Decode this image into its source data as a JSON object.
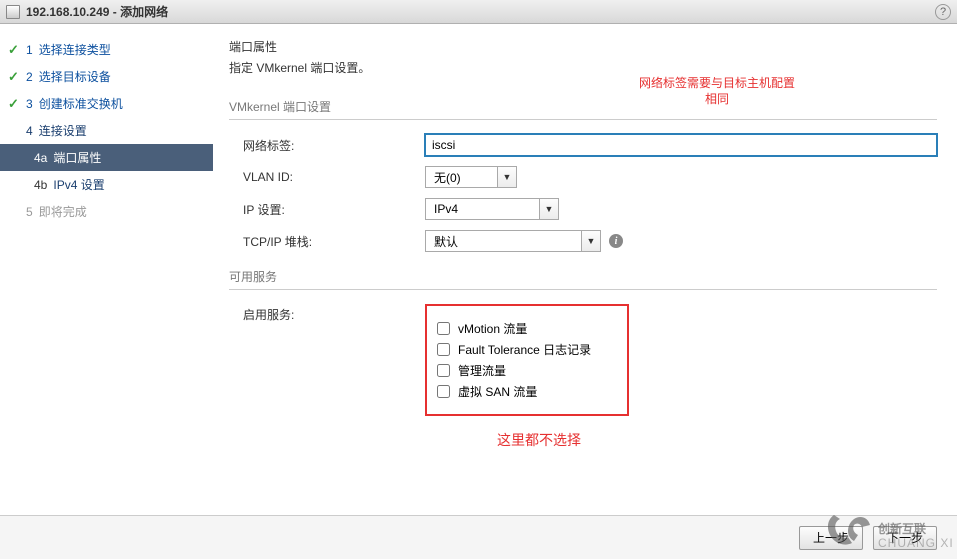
{
  "titlebar": {
    "host": "192.168.10.249",
    "suffix": " - 添加网络"
  },
  "sidebar": {
    "steps": [
      {
        "num": "1",
        "label": "选择连接类型",
        "done": true
      },
      {
        "num": "2",
        "label": "选择目标设备",
        "done": true
      },
      {
        "num": "3",
        "label": "创建标准交换机",
        "done": true
      },
      {
        "num": "4",
        "label": "连接设置",
        "done": false
      },
      {
        "num": "5",
        "label": "即将完成",
        "done": false
      }
    ],
    "substeps": [
      {
        "num": "4a",
        "label": "端口属性",
        "active": true
      },
      {
        "num": "4b",
        "label": "IPv4 设置",
        "active": false
      }
    ]
  },
  "content": {
    "title": "端口属性",
    "desc": "指定 VMkernel 端口设置。",
    "section_label": "VMkernel 端口设置",
    "form": {
      "net_label_label": "网络标签:",
      "net_label_value": "iscsi",
      "vlan_label": "VLAN ID:",
      "vlan_value": "无(0)",
      "ip_label": "IP 设置:",
      "ip_value": "IPv4",
      "tcpip_label": "TCP/IP 堆栈:",
      "tcpip_value": "默认"
    },
    "services_label": "可用服务",
    "enable_label": "启用服务:",
    "checkboxes": [
      "vMotion 流量",
      "Fault Tolerance 日志记录",
      "管理流量",
      "虚拟 SAN 流量"
    ]
  },
  "annotations": {
    "top_line1": "网络标签需要与目标主机配置",
    "top_line2": "相同",
    "bottom": "这里都不选择"
  },
  "footer": {
    "prev": "上一步",
    "next": "下一步"
  },
  "watermark": {
    "brand_cn": "创新互联",
    "brand_en": "CHUANG XIN HU LIAN"
  }
}
